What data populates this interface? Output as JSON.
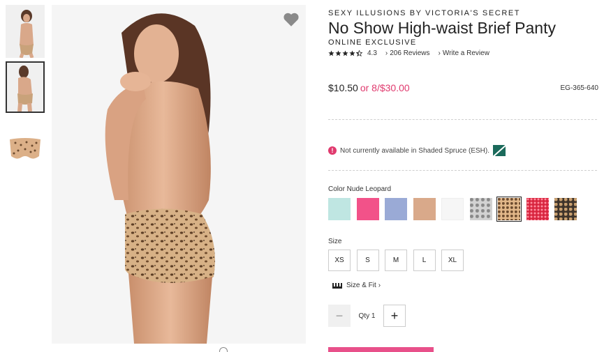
{
  "brand": "SEXY ILLUSIONS BY VICTORIA'S SECRET",
  "title": "No Show High-waist Brief Panty",
  "exclusive": "ONLINE EXCLUSIVE",
  "rating": {
    "value": 4.3,
    "display": "4.3",
    "reviews": "206 Reviews",
    "write": "Write a Review"
  },
  "price": {
    "main": "$10.50",
    "alt": "or 8/$30.00",
    "sku": "EG-365-640"
  },
  "availability": "Not currently available in Shaded Spruce (ESH).",
  "color": {
    "label": "Color Nude Leopard",
    "swatches": [
      {
        "name": "aqua",
        "hex": "#bfe6e2"
      },
      {
        "name": "pink",
        "hex": "#f25289"
      },
      {
        "name": "periwinkle",
        "hex": "#9aaad6"
      },
      {
        "name": "nude",
        "hex": "#d9a98a"
      },
      {
        "name": "white",
        "hex": "#f6f6f6"
      },
      {
        "name": "grey-leopard",
        "hex": "#cfcfcf"
      },
      {
        "name": "nude-leopard",
        "hex": "#e2b789",
        "selected": true
      },
      {
        "name": "red-lace",
        "hex": "#d8243e"
      },
      {
        "name": "dark-leopard",
        "hex": "#5b4a3a"
      }
    ]
  },
  "size": {
    "label": "Size",
    "options": [
      "XS",
      "S",
      "M",
      "L",
      "XL"
    ]
  },
  "size_fit": "Size & Fit",
  "qty": {
    "label": "Qty",
    "value": "1"
  },
  "icons": {
    "favorite": "heart-icon",
    "star": "star-icon",
    "warning": "exclamation-icon",
    "ruler": "ruler-icon"
  }
}
